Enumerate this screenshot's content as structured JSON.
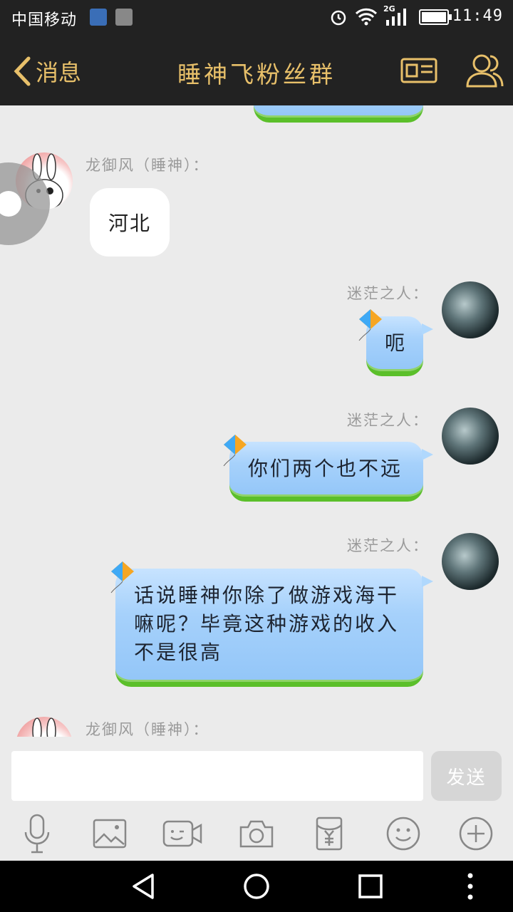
{
  "status_bar": {
    "carrier": "中国移动",
    "network": "2G",
    "time": "11:49"
  },
  "header": {
    "back_label": "消息",
    "title": "睡神飞粉丝群"
  },
  "messages": [
    {
      "sender": "龙御风（睡神）：",
      "text": "河北",
      "side": "left"
    },
    {
      "sender": "迷茫之人：",
      "text": "呃",
      "side": "right"
    },
    {
      "sender": "迷茫之人：",
      "text": "你们两个也不远",
      "side": "right"
    },
    {
      "sender": "迷茫之人：",
      "lines": [
        "话说睡神你除了做游戏海干",
        "嘛呢？毕竟这种游戏的收入",
        "不是很高"
      ],
      "side": "right"
    },
    {
      "sender": "龙御风（睡神）：",
      "side": "left"
    }
  ],
  "composer": {
    "placeholder": "",
    "send_label": "发送"
  },
  "toolbar_icons": [
    "microphone-icon",
    "image-icon",
    "video-call-icon",
    "camera-icon",
    "red-packet-icon",
    "emoji-icon",
    "plus-icon"
  ],
  "nav_icons": [
    "back-triangle-icon",
    "home-circle-icon",
    "recents-square-icon",
    "more-dots-icon"
  ],
  "colors": {
    "header_bg": "#222222",
    "header_text": "#e8c06a",
    "chat_bg": "#ebebeb",
    "bubble_blue": "#a6d1fb",
    "bubble_green_edge": "#5bbf2a"
  }
}
